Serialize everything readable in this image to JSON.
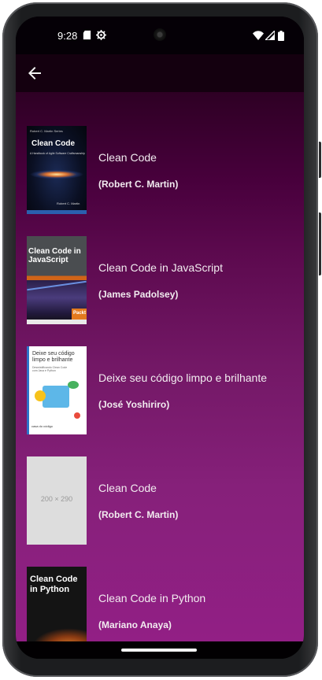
{
  "status_bar": {
    "time": "9:28",
    "left_icons": [
      "sd-card-icon",
      "settings-gear-icon"
    ],
    "right_icons": [
      "wifi-icon",
      "signal-icon",
      "battery-icon"
    ]
  },
  "app_bar": {
    "back_icon": "arrow-back-icon"
  },
  "books": [
    {
      "title": "Clean Code",
      "author": "(Robert C. Martin)",
      "cover": {
        "header_text": "Robert C. Martin Series",
        "title": "Clean Code",
        "subtitle": "A Handbook of Agile Software Craftsmanship",
        "footer_text": "Robert C. Martin"
      }
    },
    {
      "title": "Clean Code in JavaScript",
      "author": "(James Padolsey)",
      "cover": {
        "title": "Clean Code in JavaScript",
        "badge": "Packt"
      }
    },
    {
      "title": "Deixe seu código limpo e brilhante",
      "author": "(José Yoshiriro)",
      "cover": {
        "title": "Deixe seu código limpo e brilhante",
        "subtitle": "Desmistificando Clean Code com Java e Python",
        "publisher": "casa do código"
      }
    },
    {
      "title": "Clean Code",
      "author": "(Robert C. Martin)",
      "cover": {
        "placeholder": "200 × 290"
      }
    },
    {
      "title": "Clean Code in Python",
      "author": "(Mariano Anaya)",
      "cover": {
        "title": "Clean Code in Python"
      }
    }
  ]
}
